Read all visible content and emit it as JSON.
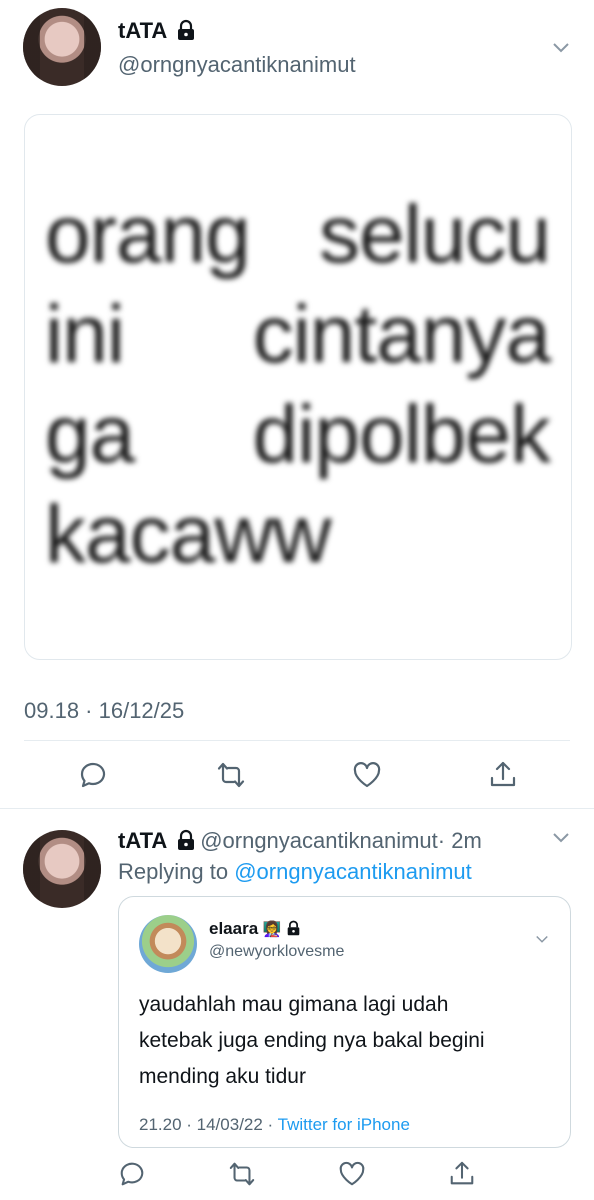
{
  "tweet": {
    "author_name": "tATA",
    "author_handle": "@orngnyacantiknanimut",
    "image_text_lines": [
      [
        "orang",
        "selucu"
      ],
      [
        "ini",
        "cintanya"
      ],
      [
        "ga",
        "dipolbek"
      ],
      [
        "kacaww"
      ]
    ],
    "timestamp": "09.18 · 16/12/25",
    "icons": [
      "reply-icon",
      "retweet-icon",
      "like-icon",
      "share-icon"
    ]
  },
  "reply": {
    "author_name": "tATA",
    "author_handle": "@orngnyacantiknanimut",
    "time": "· 2m",
    "replying_prefix": "Replying to",
    "replying_handle": "@orngnyacantiknanimut",
    "quote": {
      "name": "elaara",
      "emoji": "👩‍🏫",
      "handle": "@newyorklovesme",
      "text_lines": [
        "yaudahlah mau gimana lagi udah",
        "ketebak juga ending nya bakal begini",
        "mending aku tidur"
      ],
      "timestamp": "21.20 · 14/03/22 ·",
      "source": "Twitter for iPhone"
    }
  },
  "colors": {
    "link": "#1d9bf0",
    "secondary": "#536471",
    "icon": "#536471",
    "divider": "#e6ecf0"
  }
}
